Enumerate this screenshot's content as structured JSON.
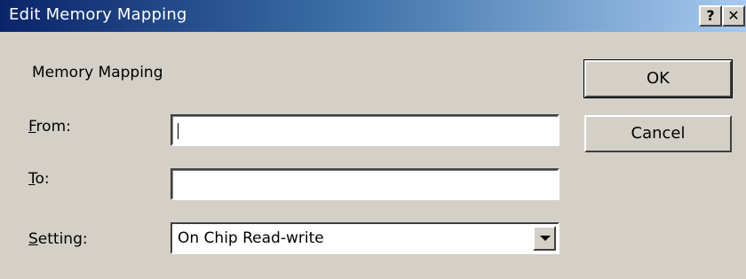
{
  "window": {
    "title": "Edit Memory Mapping",
    "help_label": "?",
    "close_label": "✕"
  },
  "group": {
    "label": "Memory Mapping"
  },
  "fields": {
    "from": {
      "label_accel": "F",
      "label_rest": "rom:",
      "value": ""
    },
    "to": {
      "label_accel": "T",
      "label_rest": "o:",
      "value": ""
    },
    "setting": {
      "label_accel": "S",
      "label_rest": "etting:",
      "value": "On Chip Read-write"
    }
  },
  "buttons": {
    "ok_label": "OK",
    "cancel_label": "Cancel"
  },
  "icons": {
    "dropdown": "chevron-down-icon",
    "help": "help-icon",
    "close": "close-icon"
  },
  "colors": {
    "dialog_bg": "#d4d0c8",
    "title_start": "#0a246a",
    "title_end": "#a6caf0"
  }
}
